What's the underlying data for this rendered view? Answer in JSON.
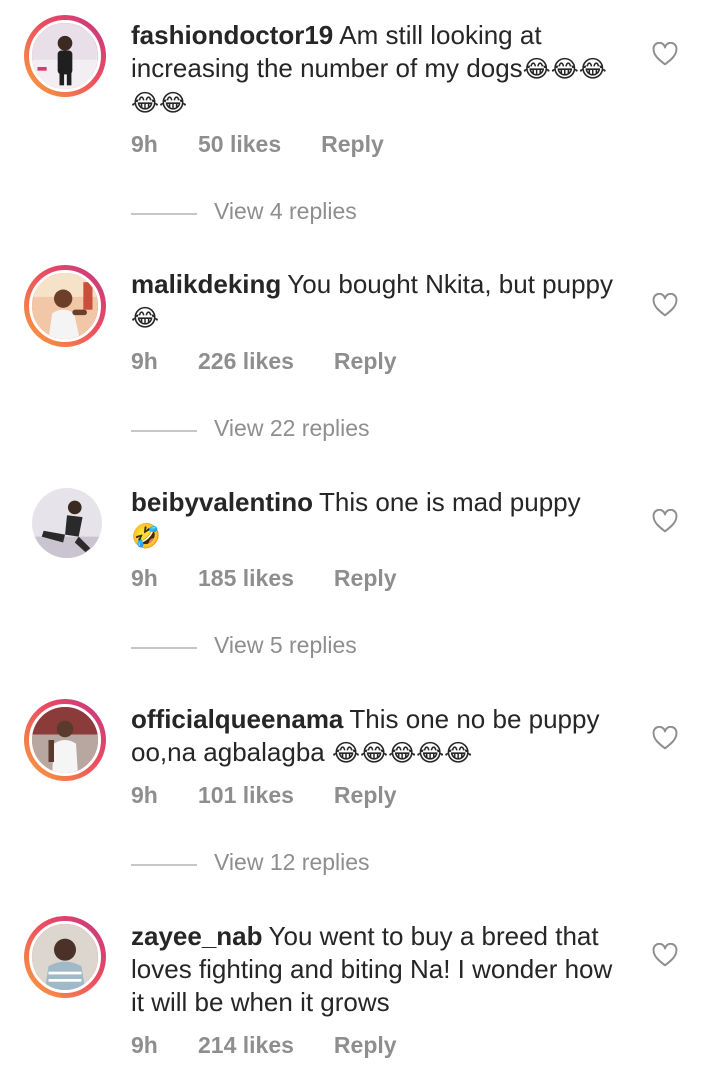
{
  "comments": [
    {
      "username": "fashiondoctor19",
      "text": "Am still looking at increasing the number of my dogs",
      "emoji": "😂😂😂😂😂",
      "time": "9h",
      "likes": "50 likes",
      "reply": "Reply",
      "view_replies": "View 4 replies",
      "avatar_icon": "user-avatar-icon",
      "story_ring": true
    },
    {
      "username": "malikdeking",
      "text": "You bought Nkita, but puppy",
      "emoji": "😂",
      "time": "9h",
      "likes": "226 likes",
      "reply": "Reply",
      "view_replies": "View 22 replies",
      "avatar_icon": "user-avatar-icon",
      "story_ring": true
    },
    {
      "username": "beibyvalentino",
      "text": "This one is mad puppy",
      "emoji": "🤣",
      "time": "9h",
      "likes": "185 likes",
      "reply": "Reply",
      "view_replies": "View 5 replies",
      "avatar_icon": "user-avatar-icon",
      "story_ring": false
    },
    {
      "username": "officialqueenama",
      "text": "This one no be puppy oo,na agbalagba",
      "emoji": "😂😂😂😂😂",
      "time": "9h",
      "likes": "101 likes",
      "reply": "Reply",
      "view_replies": "View 12 replies",
      "avatar_icon": "user-avatar-icon",
      "story_ring": true
    },
    {
      "username": "zayee_nab",
      "text": "You went to buy a breed that loves fighting and biting Na! I wonder how it will be when it grows",
      "emoji": "",
      "time": "9h",
      "likes": "214 likes",
      "reply": "Reply",
      "avatar_icon": "user-avatar-icon",
      "story_ring": true
    }
  ],
  "icons": {
    "like": "heart-outline-icon"
  },
  "colors": {
    "text": "#262626",
    "secondary": "#8e8e8e",
    "story_ring_start": "#f9a43a",
    "story_ring_end": "#c13584"
  }
}
